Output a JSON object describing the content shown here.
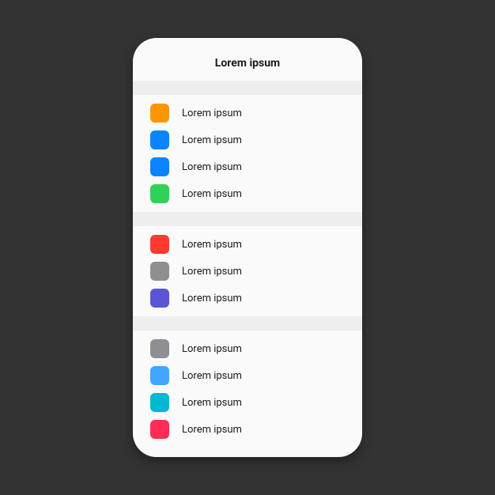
{
  "header": {
    "title": "Lorem ipsum"
  },
  "sections": [
    {
      "items": [
        {
          "color": "#FF9500",
          "label": "Lorem ipsum"
        },
        {
          "color": "#0A84FF",
          "label": "Lorem ipsum"
        },
        {
          "color": "#0A84FF",
          "label": "Lorem ipsum"
        },
        {
          "color": "#30D158",
          "label": "Lorem ipsum"
        }
      ]
    },
    {
      "items": [
        {
          "color": "#FF3B30",
          "label": "Lorem ipsum"
        },
        {
          "color": "#8E8E93",
          "label": "Lorem ipsum"
        },
        {
          "color": "#5856D6",
          "label": "Lorem ipsum"
        }
      ]
    },
    {
      "items": [
        {
          "color": "#8E8E93",
          "label": "Lorem ipsum"
        },
        {
          "color": "#3FA7FF",
          "label": "Lorem ipsum"
        },
        {
          "color": "#00B8D4",
          "label": "Lorem ipsum"
        },
        {
          "color": "#FF2D55",
          "label": "Lorem ipsum"
        }
      ]
    }
  ]
}
